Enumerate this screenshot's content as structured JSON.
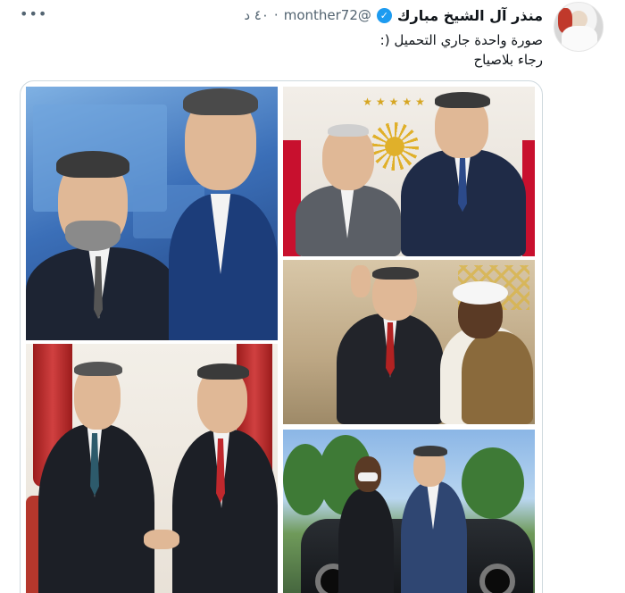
{
  "tweet": {
    "author_name": "منذر آل الشيخ مبارك",
    "verified_mark": "✓",
    "handle": "@monther72",
    "separator": "·",
    "time": "٤٠ د",
    "more": "•••",
    "text_line1": "صورة واحدة جاري التحميل (:",
    "text_line2": "رجاء بلاصياح"
  },
  "colors": {
    "verified": "#1d9bf0",
    "secondary_text": "#536471",
    "border": "#cfd9de"
  },
  "media": {
    "photo_count": 5,
    "icons": [
      "avatar",
      "verified-badge-icon",
      "more-icon"
    ]
  }
}
